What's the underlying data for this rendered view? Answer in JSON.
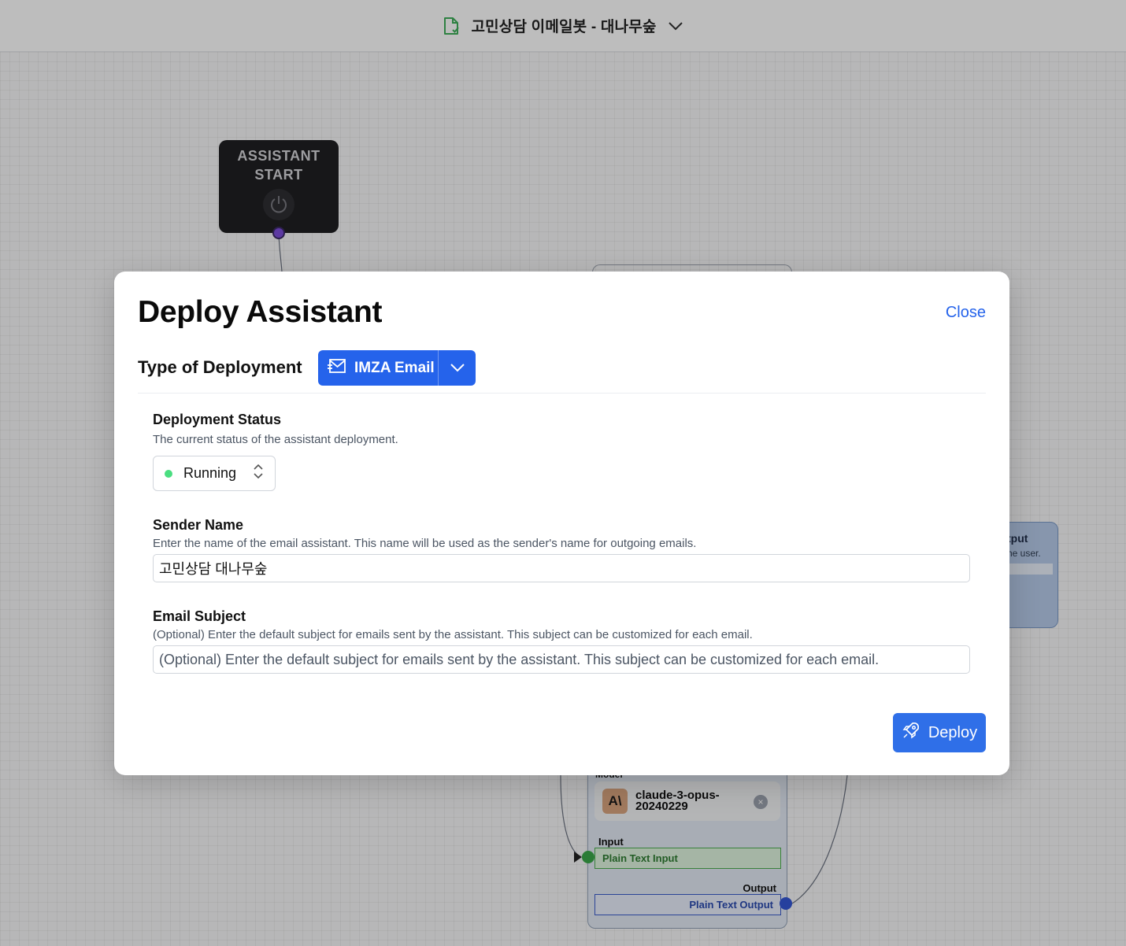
{
  "header": {
    "title": "고민상담 이메일봇 - 대나무숲",
    "doc_icon": "document-check-icon",
    "chevron_icon": "chevron-down-icon"
  },
  "canvas": {
    "start_node": {
      "line1": "ASSISTANT",
      "line2": "START"
    },
    "output_node": {
      "title": "tput",
      "subtitle": "he user."
    },
    "model_node": {
      "model_label": "Model",
      "model_name": "claude-3-opus-20240229",
      "model_logo": "A\\",
      "input_label": "Input",
      "input_value": "Plain Text Input",
      "output_label": "Output",
      "output_value": "Plain Text Output"
    }
  },
  "modal": {
    "title": "Deploy Assistant",
    "close_label": "Close",
    "type_label": "Type of Deployment",
    "type_value": "IMZA Email",
    "status": {
      "title": "Deployment Status",
      "description": "The current status of the assistant deployment.",
      "value": "Running",
      "color": "#4ade80"
    },
    "sender": {
      "title": "Sender Name",
      "description": "Enter the name of the email assistant. This name will be used as the sender's name for outgoing emails.",
      "value": "고민상담 대나무숲"
    },
    "subject": {
      "title": "Email Subject",
      "description": "(Optional) Enter the default subject for emails sent by the assistant. This subject can be customized for each email.",
      "placeholder": "(Optional) Enter the default subject for emails sent by the assistant. This subject can be customized for each email.",
      "value": ""
    },
    "deploy_label": "Deploy"
  },
  "colors": {
    "accent": "#2563eb",
    "deploy": "#2f6fe8",
    "status_running": "#4ade80"
  }
}
